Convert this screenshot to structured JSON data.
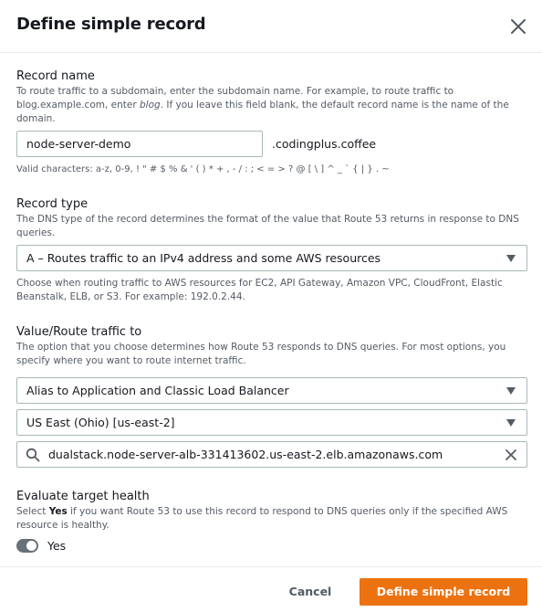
{
  "modal": {
    "title": "Define simple record",
    "close_icon": "close-icon"
  },
  "record_name": {
    "label": "Record name",
    "description_part1": "To route traffic to a subdomain, enter the subdomain name. For example, to route traffic to blog.example.com, enter ",
    "description_emph": "blog",
    "description_part2": ". If you leave this field blank, the default record name is the name of the domain.",
    "value": "node-server-demo",
    "suffix": ".codingplus.coffee",
    "hint": "Valid characters: a-z, 0-9, ! \" # $ % & ' ( ) * + , - / : ; < = > ? @ [ \\ ] ^ _ ` { | } . ~"
  },
  "record_type": {
    "label": "Record type",
    "description": "The DNS type of the record determines the format of the value that Route 53 returns in response to DNS queries.",
    "selected": "A – Routes traffic to an IPv4 address and some AWS resources",
    "hint": "Choose when routing traffic to AWS resources for EC2, API Gateway, Amazon VPC, CloudFront, Elastic Beanstalk, ELB, or S3. For example: 192.0.2.44."
  },
  "value_route": {
    "label": "Value/Route traffic to",
    "description": "The option that you choose determines how Route 53 responds to DNS queries. For most options, you specify where you want to route internet traffic.",
    "endpoint_selected": "Alias to Application and Classic Load Balancer",
    "region_selected": "US East (Ohio) [us-east-2]",
    "search_value": "dualstack.node-server-alb-331413602.us-east-2.elb.amazonaws.com"
  },
  "health": {
    "label": "Evaluate target health",
    "description_part1": "Select ",
    "description_bold": "Yes",
    "description_part2": " if you want Route 53 to use this record to respond to DNS queries only if the specified AWS resource is healthy.",
    "toggle_label": "Yes",
    "toggle_on": true
  },
  "footer": {
    "cancel_label": "Cancel",
    "submit_label": "Define simple record"
  },
  "colors": {
    "primary": "#ec7211",
    "toggle_on": "#687078",
    "border": "#aab7b8"
  }
}
